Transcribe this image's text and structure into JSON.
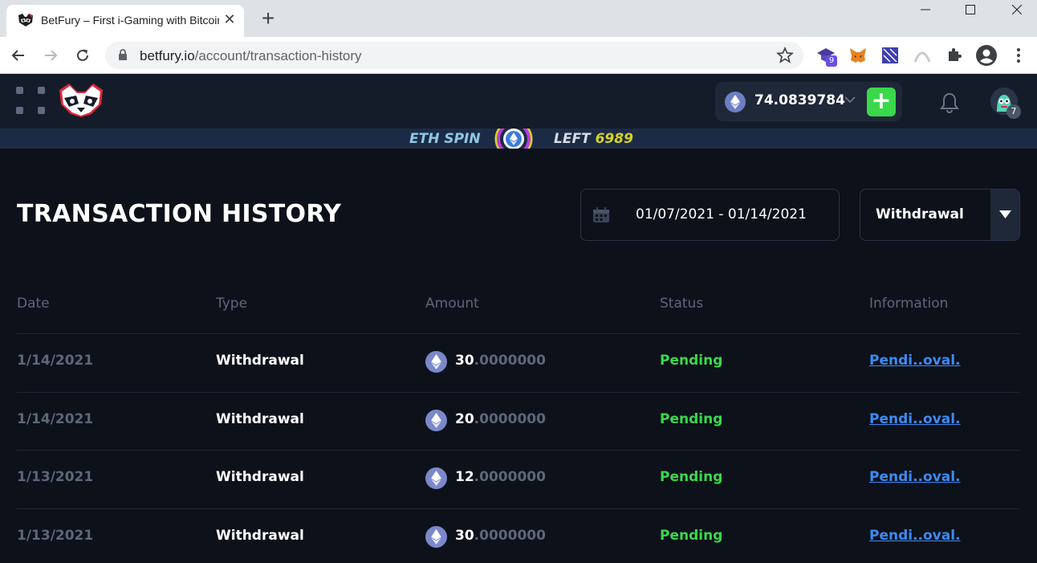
{
  "browser": {
    "tab_title": "BetFury – First i-Gaming with Bitcoin",
    "url_host": "betfury.io",
    "url_path": "/account/transaction-history",
    "extension_badge": "9"
  },
  "header": {
    "balance": "74.0839784",
    "notification_count": "7"
  },
  "promo": {
    "left_text": "ETH SPIN",
    "right_text": "LEFT",
    "count": "6989"
  },
  "page": {
    "title": "TRANSACTION HISTORY",
    "date_range": "01/07/2021 - 01/14/2021",
    "type_filter": "Withdrawal"
  },
  "table": {
    "columns": [
      "Date",
      "Type",
      "Amount",
      "Status",
      "Information"
    ],
    "rows": [
      {
        "date": "1/14/2021",
        "type": "Withdrawal",
        "amount_int": "30",
        "amount_dec": ".0000000",
        "status": "Pending",
        "info": "Pendi..oval."
      },
      {
        "date": "1/14/2021",
        "type": "Withdrawal",
        "amount_int": "20",
        "amount_dec": ".0000000",
        "status": "Pending",
        "info": "Pendi..oval."
      },
      {
        "date": "1/13/2021",
        "type": "Withdrawal",
        "amount_int": "12",
        "amount_dec": ".0000000",
        "status": "Pending",
        "info": "Pendi..oval."
      },
      {
        "date": "1/13/2021",
        "type": "Withdrawal",
        "amount_int": "30",
        "amount_dec": ".0000000",
        "status": "Pending",
        "info": "Pendi..oval."
      }
    ]
  },
  "colors": {
    "background": "#0d111a",
    "header": "#151c29",
    "status_pending": "#3ad84a",
    "link": "#3b8bf5",
    "accent_yellow": "#d8d323"
  },
  "icons": [
    "raccoon-logo-icon",
    "grid-menu-icon",
    "ethereum-icon",
    "chevron-down-icon",
    "plus-icon",
    "bell-icon",
    "avatar-icon",
    "calendar-icon",
    "triangle-down-icon",
    "lock-icon",
    "star-icon",
    "back-arrow-icon",
    "forward-arrow-icon",
    "reload-icon",
    "puzzle-extension-icon",
    "account-icon",
    "kebab-menu-icon"
  ]
}
